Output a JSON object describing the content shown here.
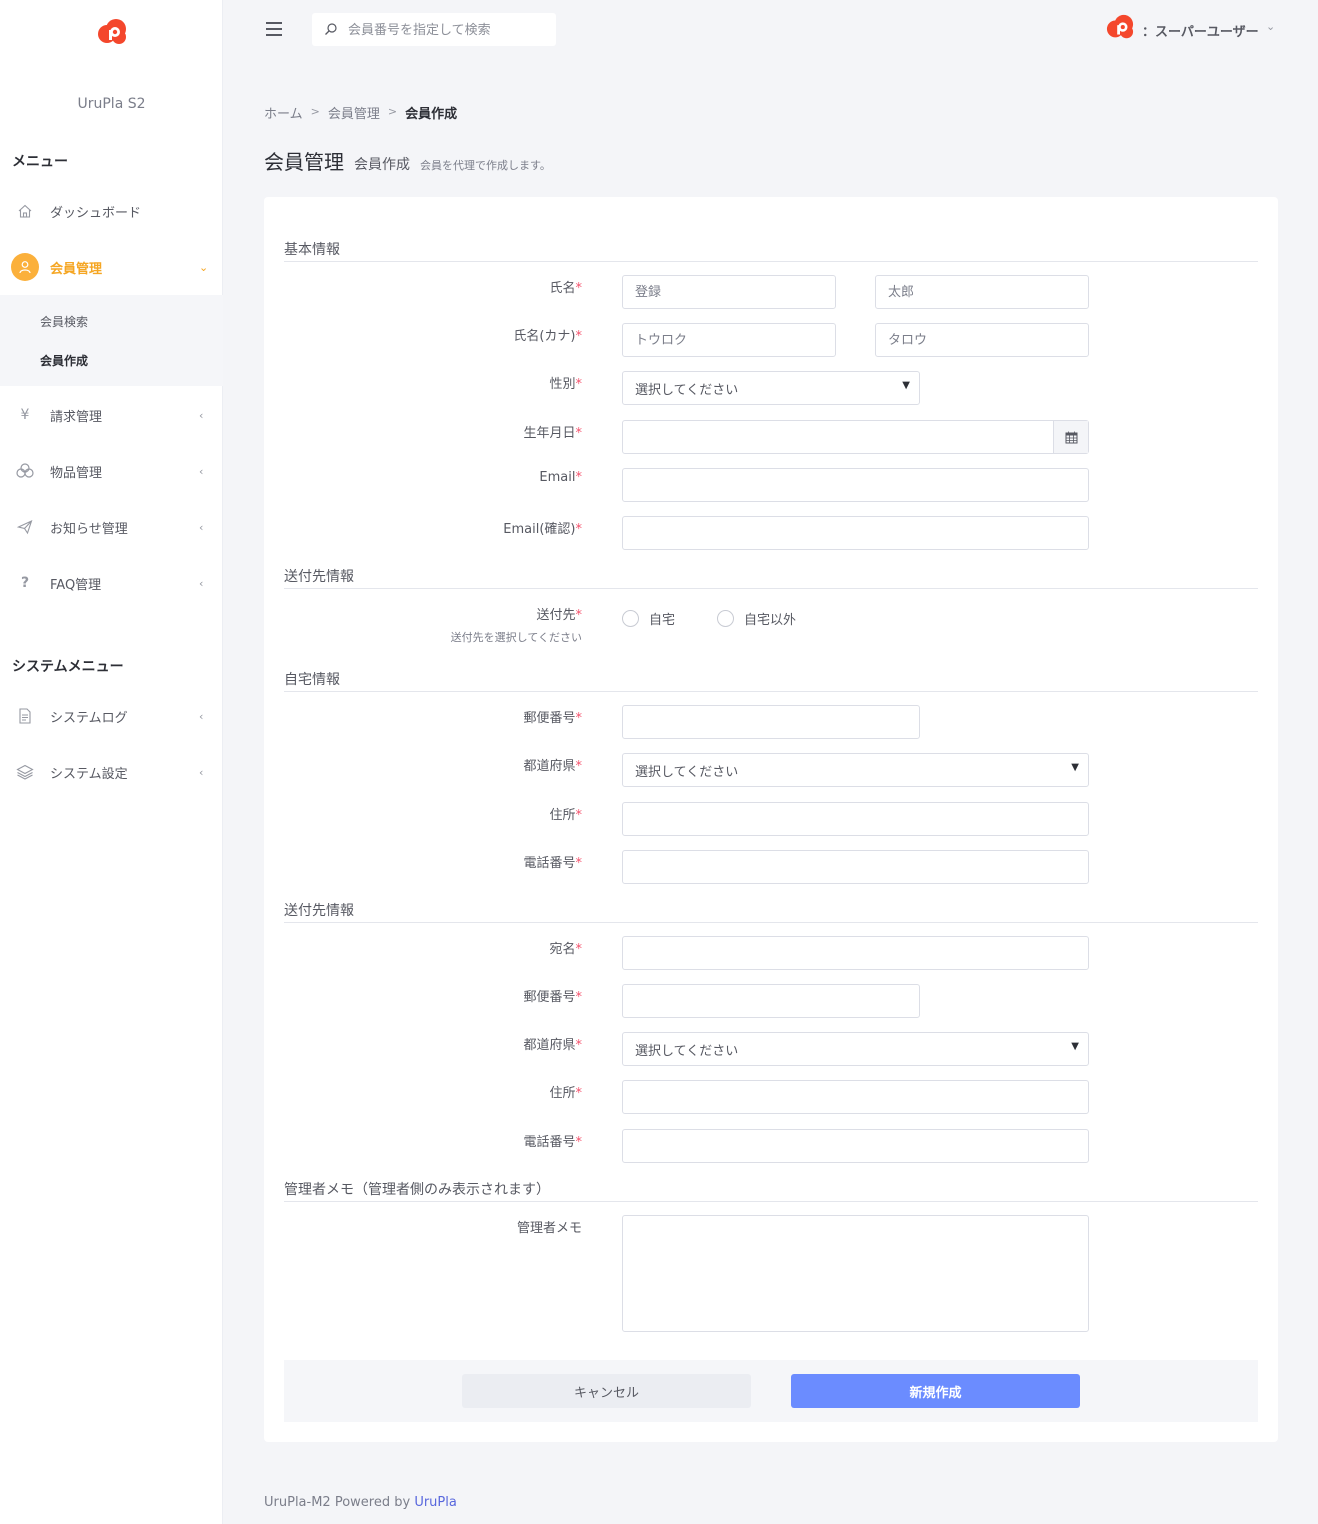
{
  "colors": {
    "accent": "#fbb03b",
    "brand_red": "#f4472c",
    "primary": "#6b8cff",
    "required": "#f4516c",
    "link": "#5867dd"
  },
  "sidebar": {
    "brand": "UruPla S2",
    "menu_title": "メニュー",
    "items": [
      {
        "label": "ダッシュボード",
        "icon": "home-icon"
      },
      {
        "label": "会員管理",
        "icon": "user-icon"
      },
      {
        "label": "請求管理",
        "icon": "yen-icon"
      },
      {
        "label": "物品管理",
        "icon": "boxes-icon"
      },
      {
        "label": "お知らせ管理",
        "icon": "paper-plane-icon"
      },
      {
        "label": "FAQ管理",
        "icon": "question-icon"
      }
    ],
    "submenu": [
      "会員検索",
      "会員作成"
    ],
    "system_title": "システムメニュー",
    "system_items": [
      {
        "label": "システムログ",
        "icon": "document-icon"
      },
      {
        "label": "システム設定",
        "icon": "layers-icon"
      }
    ]
  },
  "topbar": {
    "search_placeholder": "会員番号を指定して検索",
    "user_name": "：スーパーユーザー"
  },
  "breadcrumb": [
    "ホーム",
    "会員管理",
    "会員作成"
  ],
  "page": {
    "title": "会員管理",
    "subtitle": "会員作成",
    "description": "会員を代理で作成します。"
  },
  "form": {
    "required_mark": "*",
    "sections": {
      "basic": "基本情報",
      "delivery": "送付先情報",
      "home": "自宅情報",
      "delivery2": "送付先情報",
      "memo": "管理者メモ（管理者側のみ表示されます）"
    },
    "labels": {
      "name": "氏名",
      "name_kana": "氏名(カナ)",
      "gender": "性別",
      "birthday": "生年月日",
      "email": "Email",
      "email_confirm": "Email(確認)",
      "destination": "送付先",
      "destination_help": "送付先を選択してください",
      "postal": "郵便番号",
      "prefecture": "都道府県",
      "address": "住所",
      "phone": "電話番号",
      "recipient": "宛名",
      "memo": "管理者メモ"
    },
    "placeholders": {
      "last_name": "登録",
      "first_name": "太郎",
      "last_kana": "トウロク",
      "first_kana": "タロウ"
    },
    "select_default": "選択してください",
    "radio_options": [
      "自宅",
      "自宅以外"
    ],
    "buttons": {
      "cancel": "キャンセル",
      "create": "新規作成"
    }
  },
  "footer": {
    "text": "UruPla-M2 Powered by ",
    "link": "UruPla"
  }
}
